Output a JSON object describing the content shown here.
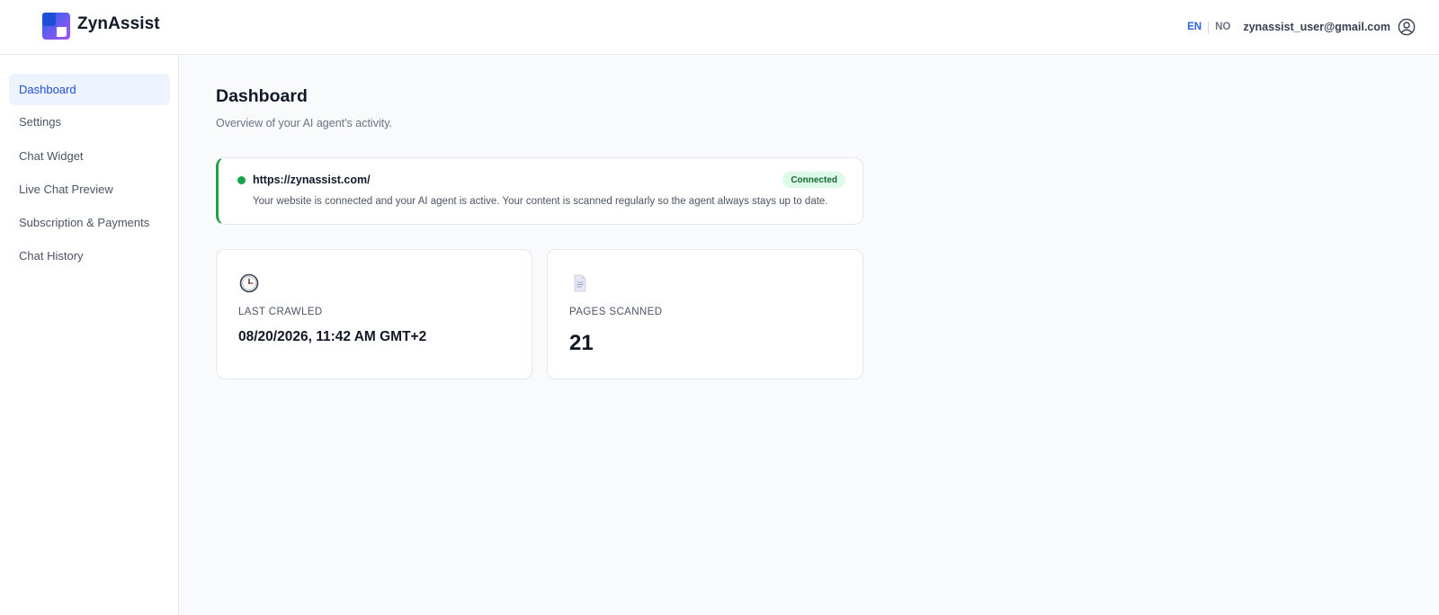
{
  "app": {
    "brand_name": "ZynAssist",
    "brand_color": "#4f46e5"
  },
  "header": {
    "languages": [
      "EN",
      "NO"
    ],
    "active_language": "EN",
    "user_email": "zynassist_user@gmail.com",
    "user_icon": "user-circle-icon"
  },
  "sidebar": {
    "active_item": "Dashboard",
    "items": [
      {
        "label": "Dashboard"
      },
      {
        "label": "Settings"
      },
      {
        "label": "Chat Widget"
      },
      {
        "label": "Live Chat Preview"
      },
      {
        "label": "Subscription & Payments"
      },
      {
        "label": "Chat History"
      }
    ]
  },
  "main": {
    "title": "Dashboard",
    "subtitle": "Overview of your AI agent's activity.",
    "status": {
      "url": "https://zynassist.com/",
      "badge": "Connected",
      "description": "Your website is connected and your AI agent is active. Your content is scanned regularly so the agent always stays up to date.",
      "color": "#16a34a"
    },
    "stats": [
      {
        "icon": "clock-icon",
        "label": "LAST CRAWLED",
        "value": "08/20/2026, 11:42 AM GMT+2"
      },
      {
        "icon": "document-icon",
        "label": "PAGES SCANNED",
        "value": "21"
      }
    ]
  }
}
